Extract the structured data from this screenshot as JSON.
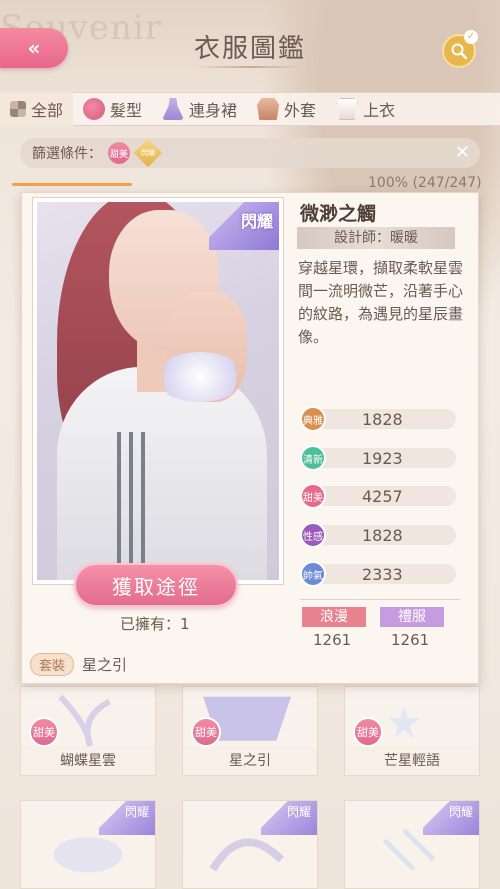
{
  "header": {
    "title": "衣服圖鑑",
    "back_icon": "double-chevron-left",
    "search_icon": "magnifier"
  },
  "tabs": [
    {
      "label": "全部",
      "icon": "grid-icon",
      "active": true
    },
    {
      "label": "髮型",
      "icon": "hair-icon",
      "active": false
    },
    {
      "label": "連身裙",
      "icon": "dress-icon",
      "active": false
    },
    {
      "label": "外套",
      "icon": "coat-icon",
      "active": false
    },
    {
      "label": "上衣",
      "icon": "top-icon",
      "active": false
    }
  ],
  "filter": {
    "label": "篩選條件：",
    "tags": [
      "甜美",
      "閃耀"
    ],
    "close": "✕"
  },
  "collection_progress": "100% (247/247)",
  "detail": {
    "badge": "閃耀",
    "name": "微渺之觸",
    "designer": "設計師：暖暖",
    "description": "穿越星環，擷取柔軟星雲間一流明微芒，沿著手心的紋路，為遇見的星辰畫像。",
    "get_button": "獲取途徑",
    "owned": "已擁有：1",
    "set_tag": "套裝",
    "set_name": "星之引",
    "stats": [
      {
        "label": "典雅",
        "value": "1828",
        "color": "#d9904f"
      },
      {
        "label": "清新",
        "value": "1923",
        "color": "#4fbf9a"
      },
      {
        "label": "甜美",
        "value": "4257",
        "color": "#e66a8c"
      },
      {
        "label": "性感",
        "value": "1828",
        "color": "#9b5bbd"
      },
      {
        "label": "帥氣",
        "value": "2333",
        "color": "#6a8bd6"
      }
    ],
    "styles": [
      {
        "label": "浪漫",
        "value": "1261",
        "color": "#e8828f"
      },
      {
        "label": "禮服",
        "value": "1261",
        "color": "#c79be0"
      }
    ]
  },
  "grid": [
    {
      "label": "蝴蝶星雲",
      "tag": "甜美"
    },
    {
      "label": "星之引",
      "tag": "甜美"
    },
    {
      "label": "芒星輕語",
      "tag": "甜美"
    },
    {
      "label": "",
      "badge": "閃耀"
    },
    {
      "label": "",
      "badge": "閃耀"
    },
    {
      "label": "",
      "badge": "閃耀"
    }
  ]
}
